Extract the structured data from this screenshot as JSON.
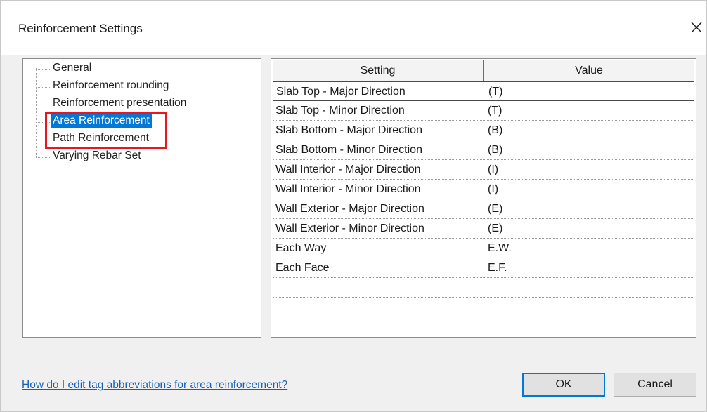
{
  "window": {
    "title": "Reinforcement Settings",
    "close_glyph": "close-icon"
  },
  "tree": {
    "items": [
      {
        "label": "General",
        "selected": false
      },
      {
        "label": "Reinforcement rounding",
        "selected": false
      },
      {
        "label": "Reinforcement presentation",
        "selected": false
      },
      {
        "label": "Area Reinforcement",
        "selected": true
      },
      {
        "label": "Path Reinforcement",
        "selected": false
      },
      {
        "label": "Varying Rebar Set",
        "selected": false
      }
    ]
  },
  "table": {
    "headers": {
      "setting": "Setting",
      "value": "Value"
    },
    "rows": [
      {
        "setting": "Slab Top - Major Direction",
        "value": "(T)"
      },
      {
        "setting": "Slab Top - Minor Direction",
        "value": "(T)"
      },
      {
        "setting": "Slab Bottom - Major Direction",
        "value": "(B)"
      },
      {
        "setting": "Slab Bottom - Minor Direction",
        "value": "(B)"
      },
      {
        "setting": "Wall Interior - Major Direction",
        "value": "(I)"
      },
      {
        "setting": "Wall Interior - Minor Direction",
        "value": "(I)"
      },
      {
        "setting": "Wall Exterior - Major Direction",
        "value": "(E)"
      },
      {
        "setting": "Wall Exterior - Minor Direction",
        "value": "(E)"
      },
      {
        "setting": "Each Way",
        "value": "E.W."
      },
      {
        "setting": "Each Face",
        "value": "E.F."
      }
    ]
  },
  "footer": {
    "help_link": "How do I edit tag abbreviations for area reinforcement?",
    "ok_label": "OK",
    "cancel_label": "Cancel"
  },
  "colors": {
    "selection": "#0078d7",
    "highlight_box": "#e8161f",
    "link": "#1a5fb4"
  }
}
